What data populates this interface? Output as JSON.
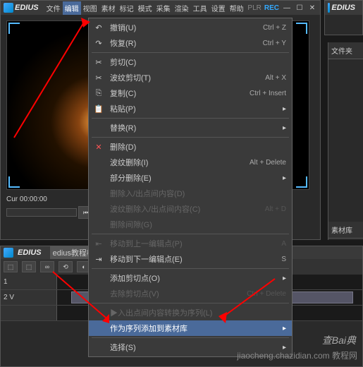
{
  "app": {
    "name": "EDIUS"
  },
  "menubar": {
    "items": [
      "文件",
      "编辑",
      "视图",
      "素材",
      "标记",
      "模式",
      "采集",
      "渲染",
      "工具",
      "设置",
      "帮助"
    ],
    "active_index": 1
  },
  "titlebar": {
    "plr": "PLR",
    "rec": "REC"
  },
  "right_win_title": "EDIUS",
  "right_panel": {
    "tab1": "文件夹",
    "tab2": "素材库"
  },
  "timecode": "Cur 00:00:00",
  "timeline": {
    "title": "EDIUS",
    "subtitle": "edius教程模",
    "tracks": [
      {
        "label": "1"
      },
      {
        "label": "2 V"
      },
      {
        "label": ""
      }
    ]
  },
  "ctx": {
    "undo": {
      "label": "撤销(U)",
      "shortcut": "Ctrl + Z",
      "icon": "↶"
    },
    "redo": {
      "label": "恢复(R)",
      "shortcut": "Ctrl + Y",
      "icon": "↷"
    },
    "cut": {
      "label": "剪切(C)",
      "icon": "✂"
    },
    "ripple_cut": {
      "label": "波纹剪切(T)",
      "shortcut": "Alt + X",
      "icon": "✂"
    },
    "copy": {
      "label": "复制(C)",
      "shortcut": "Ctrl + Insert",
      "icon": "⎘"
    },
    "paste": {
      "label": "粘贴(P)",
      "icon": "📋",
      "has_sub": true
    },
    "replace": {
      "label": "替换(R)",
      "has_sub": true
    },
    "delete": {
      "label": "删除(D)",
      "icon": "✕"
    },
    "ripple_delete": {
      "label": "波纹删除(I)",
      "shortcut": "Alt + Delete"
    },
    "partial_delete": {
      "label": "部分删除(E)",
      "has_sub": true
    },
    "del_io_content": {
      "label": "删除入/出点间内容(D)"
    },
    "ripple_del_io": {
      "label": "波纹删除入/出点间内容(C)",
      "shortcut": "Alt + D"
    },
    "del_gap": {
      "label": "删除间隙(G)"
    },
    "prev_edit": {
      "label": "移动到上一编辑点(P)",
      "shortcut": "A",
      "icon": "⇤"
    },
    "next_edit": {
      "label": "移动到下一编辑点(E)",
      "shortcut": "S",
      "icon": "⇥"
    },
    "add_cut": {
      "label": "添加剪切点(O)",
      "has_sub": true
    },
    "del_cut": {
      "label": "去除剪切点(V)",
      "shortcut": "Ctrl + Delete"
    },
    "io_to_seq": {
      "label": "▶入出点间内容转换为序列(L)"
    },
    "add_to_bin": {
      "label": "作为序列添加到素材库",
      "has_sub": true
    },
    "select": {
      "label": "选择(S)",
      "has_sub": true
    }
  },
  "watermark": {
    "line1": "查Bai典",
    "line2": "jiaocheng.chazidian.com 教程网"
  }
}
